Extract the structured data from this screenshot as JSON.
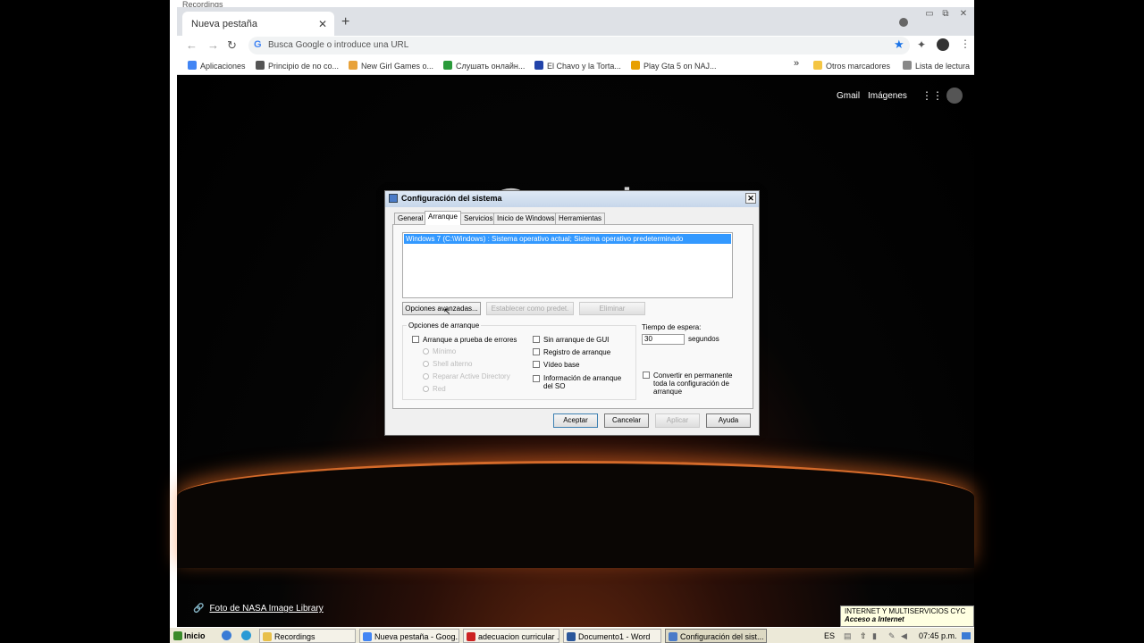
{
  "background_window": {
    "title": "Recordings"
  },
  "browser": {
    "tab": {
      "title": "Nueva pestaña",
      "close": "✕"
    },
    "new_tab": "+",
    "window_controls": {
      "minimize": "▭",
      "restore": "⧉",
      "close": "✕"
    },
    "nav": {
      "back": "←",
      "forward": "→",
      "reload": "↻"
    },
    "omnibox": {
      "placeholder": "Busca Google o introduce una URL",
      "g": "G"
    },
    "bookmarks": [
      {
        "label": "Aplicaciones",
        "icon_color": "#4285f4"
      },
      {
        "label": "Principio de no co...",
        "icon_color": "#555555"
      },
      {
        "label": "New Girl Games o...",
        "icon_color": "#e8a23a"
      },
      {
        "label": "Слушать онлайн...",
        "icon_color": "#2a9a3a"
      },
      {
        "label": "El Chavo y la Torta...",
        "icon_color": "#2244aa"
      },
      {
        "label": "Play Gta 5 on NAJ...",
        "icon_color": "#e8a000"
      }
    ],
    "overflow": "»",
    "other_bookmarks": "Otros marcadores",
    "reading_list": "Lista de lectura"
  },
  "google": {
    "gmail": "Gmail",
    "images": "Imágenes",
    "logo": "Google",
    "credit": "Foto de NASA Image Library"
  },
  "dialog": {
    "title": "Configuración del sistema",
    "close": "✕",
    "tabs": [
      "General",
      "Arranque",
      "Servicios",
      "Inicio de Windows",
      "Herramientas"
    ],
    "active_tab": "Arranque",
    "os_entry": "Windows 7 (C:\\Windows) : Sistema operativo actual; Sistema operativo predeterminado",
    "buttons_top": {
      "advanced": "Opciones avanzadas...",
      "set_default": "Establecer como predet.",
      "delete": "Eliminar"
    },
    "boot_options": {
      "group": "Opciones de arranque",
      "safe_boot": "Arranque a prueba de errores",
      "minimal": "Mínimo",
      "alt_shell": "Shell alterno",
      "ad_repair": "Reparar Active Directory",
      "network": "Red",
      "no_gui": "Sin arranque de GUI",
      "boot_log": "Registro de arranque",
      "base_video": "Vídeo base",
      "os_info": "Información de arranque del SO"
    },
    "timeout": {
      "label": "Tiempo de espera:",
      "value": "30",
      "unit": "segundos"
    },
    "permanent": "Convertir en permanente toda la configuración de arranque",
    "buttons_bottom": {
      "ok": "Aceptar",
      "cancel": "Cancelar",
      "apply": "Aplicar",
      "help": "Ayuda"
    }
  },
  "taskbar": {
    "start": "Inicio",
    "items": [
      {
        "label": "Recordings",
        "icon_color": "#e8c04a"
      },
      {
        "label": "Nueva pestaña - Goog...",
        "icon_color": "#4285f4"
      },
      {
        "label": "adecuacion curricular ...",
        "icon_color": "#cc2222"
      },
      {
        "label": "Documento1 - Word",
        "icon_color": "#2b579a"
      },
      {
        "label": "Configuración del sist...",
        "icon_color": "#4a7bc8"
      }
    ],
    "lang": "ES",
    "time": "07:45 p.m."
  },
  "notification": {
    "line1": "INTERNET Y MULTISERVICIOS CYC",
    "line2": "Acceso a Internet"
  }
}
